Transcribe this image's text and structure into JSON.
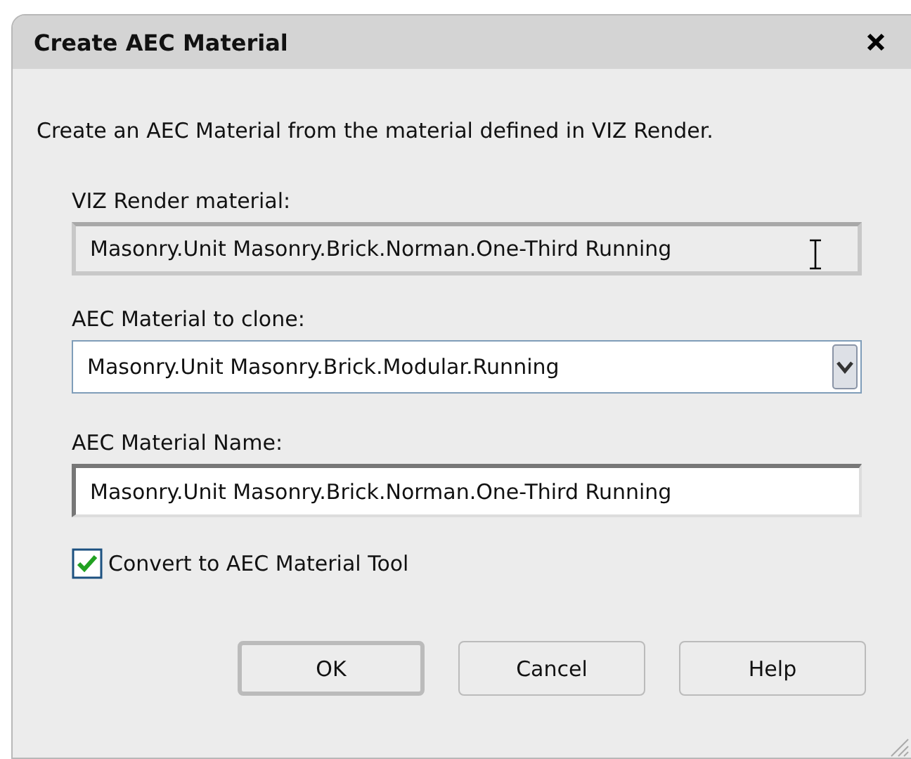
{
  "window": {
    "title": "Create AEC Material"
  },
  "intro": "Create an AEC Material from the material defined in VIZ Render.",
  "viz_material": {
    "label": "VIZ Render material:",
    "value": "Masonry.Unit Masonry.Brick.Norman.One-Third Running",
    "disabled": true
  },
  "clone_material": {
    "label": "AEC Material to clone:",
    "value": "Masonry.Unit Masonry.Brick.Modular.Running"
  },
  "material_name": {
    "label": "AEC Material Name:",
    "value": "Masonry.Unit Masonry.Brick.Norman.One-Third Running"
  },
  "convert": {
    "label": "Convert to AEC Material Tool",
    "checked": true
  },
  "buttons": [
    {
      "label": "OK",
      "default": true
    },
    {
      "label": "Cancel",
      "default": false
    },
    {
      "label": "Help",
      "default": false
    }
  ]
}
